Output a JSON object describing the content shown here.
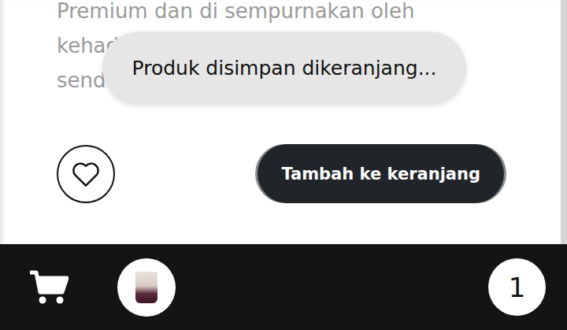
{
  "description": {
    "lines": [
      "Premium dan di sempurnakan oleh",
      "kehad",
      "send"
    ]
  },
  "favorite": {
    "selected": false
  },
  "add_button": {
    "label": "Tambah ke keranjang"
  },
  "cart_bar": {
    "count": "1"
  },
  "toast": {
    "text": "Produk disimpan dikeranjang..."
  }
}
